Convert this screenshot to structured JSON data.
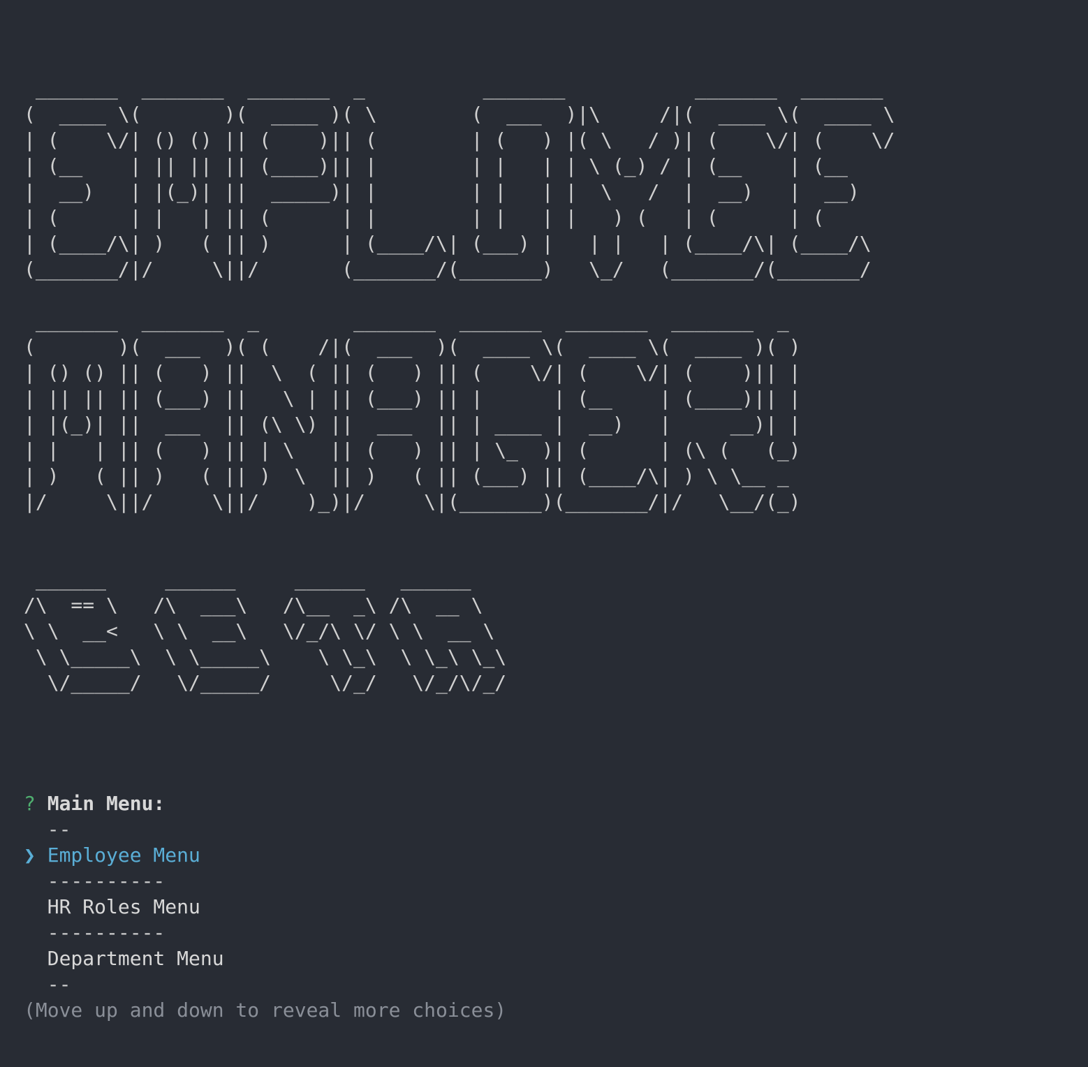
{
  "banner": {
    "employee": " _______  _______  _______  _          _______           _______  _______ \n(  ____ \\(       )(  ____ )( \\        (  ___  )|\\     /|(  ____ \\(  ____ \\\n| (    \\/| () () || (    )|| (        | (   ) |( \\   / )| (    \\/| (    \\/\n| (__    | || || || (____)|| |        | |   | | \\ (_) / | (__    | (__    \n|  __)   | |(_)| ||  _____)| |        | |   | |  \\   /  |  __)   |  __)   \n| (      | |   | || (      | |        | |   | |   ) (   | (      | (      \n| (____/\\| )   ( || )      | (____/\\| (___) |   | |   | (____/\\| (____/\\\n(_______/|/     \\||/       (_______/(_______)   \\_/   (_______/(_______/",
    "manager": " _______  _______  _        _______  _______  _______  _______  _ \n(       )(  ___  )( (    /|(  ___  )(  ____ \\(  ____ \\(  ____ )( )\n| () () || (   ) ||  \\  ( || (   ) || (    \\/| (    \\/| (    )|| |\n| || || || (___) ||   \\ | || (___) || |      | (__    | (____)|| |\n| |(_)| ||  ___  || (\\ \\) ||  ___  || | ____ |  __)   |     __)| |\n| |   | || (   ) || | \\   || (   ) || | \\_  )| (      | (\\ (   (_)\n| )   ( || )   ( || )  \\  || )   ( || (___) || (____/\\| ) \\ \\__ _ \n|/     \\||/     \\||/    )_)|/     \\|(_______)(_______/|/   \\__/(_)",
    "beta": " ______     ______     ______   ______    \n/\\  == \\   /\\  ___\\   /\\__  _\\ /\\  __ \\   \n\\ \\  __<   \\ \\  __\\   \\/_/\\ \\/ \\ \\  __ \\  \n \\ \\_____\\  \\ \\_____\\    \\ \\_\\  \\ \\_\\ \\_\\ \n  \\/_____/   \\/_____/     \\/_/   \\/_/\\/_/ "
  },
  "prompt": {
    "question_mark": "?",
    "label": "Main Menu:",
    "pointer": "❯",
    "items": [
      {
        "type": "separator",
        "text": "  --"
      },
      {
        "type": "choice",
        "text": "Employee Menu",
        "selected": true
      },
      {
        "type": "separator",
        "text": "  ----------"
      },
      {
        "type": "choice",
        "text": "HR Roles Menu",
        "selected": false
      },
      {
        "type": "separator",
        "text": "  ----------"
      },
      {
        "type": "choice",
        "text": "Department Menu",
        "selected": false
      },
      {
        "type": "separator",
        "text": "  --"
      }
    ],
    "hint": "(Move up and down to reveal more choices)"
  },
  "colors": {
    "background": "#282c34",
    "question": "#4fae6f",
    "selected": "#5aaed6",
    "hint": "#8a8f98"
  }
}
